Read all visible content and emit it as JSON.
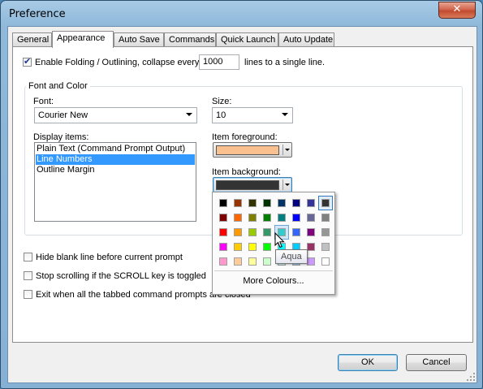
{
  "window": {
    "title": "Preference",
    "close_glyph": "✕",
    "close_icon": "close-icon"
  },
  "tabs": [
    {
      "label": "General"
    },
    {
      "label": "Appearance",
      "active": true
    },
    {
      "label": "Auto Save"
    },
    {
      "label": "Commands"
    },
    {
      "label": "Quick Launch"
    },
    {
      "label": "Auto Update"
    }
  ],
  "folding": {
    "checked": true,
    "label_pre": "Enable Folding / Outlining,  collapse every",
    "value": "1000",
    "label_post": "lines to a single line."
  },
  "font_color": {
    "title": "Font and Color",
    "font_label": "Font:",
    "font_value": "Courier New",
    "size_label": "Size:",
    "size_value": "10",
    "display_items_label": "Display items:",
    "display_items": [
      "Plain Text (Command Prompt Output)",
      "Line Numbers",
      "Outline Margin"
    ],
    "selected_index": 1,
    "foreground_label": "Item foreground:",
    "foreground_color": "#fac090",
    "background_label": "Item background:",
    "background_color": "#333333"
  },
  "options": [
    {
      "label": "Hide blank line before current prompt",
      "checked": false
    },
    {
      "label": "Stop scrolling if the SCROLL key is toggled",
      "checked": false
    },
    {
      "label": "Exit when all the tabbed command prompts are closed",
      "checked": false
    }
  ],
  "palette": {
    "colors": [
      [
        "#000000",
        "#993300",
        "#333300",
        "#003300",
        "#003366",
        "#000080",
        "#333399",
        "#333333"
      ],
      [
        "#800000",
        "#ff6600",
        "#808000",
        "#008000",
        "#008080",
        "#0000ff",
        "#666699",
        "#808080"
      ],
      [
        "#ff0000",
        "#ff9900",
        "#99cc00",
        "#339966",
        "#33cccc",
        "#3366ff",
        "#800080",
        "#969696"
      ],
      [
        "#ff00ff",
        "#ffcc00",
        "#ffff00",
        "#00ff00",
        "#00ffff",
        "#00ccff",
        "#993366",
        "#c0c0c0"
      ],
      [
        "#ff99cc",
        "#ffcc99",
        "#ffff99",
        "#ccffcc",
        "#ccffff",
        "#99ccff",
        "#cc99ff",
        "#ffffff"
      ]
    ],
    "selected": [
      0,
      7
    ],
    "hover": [
      2,
      4
    ],
    "more_label": "More Colours...",
    "tooltip": "Aqua"
  },
  "buttons": {
    "ok": "OK",
    "cancel": "Cancel"
  }
}
